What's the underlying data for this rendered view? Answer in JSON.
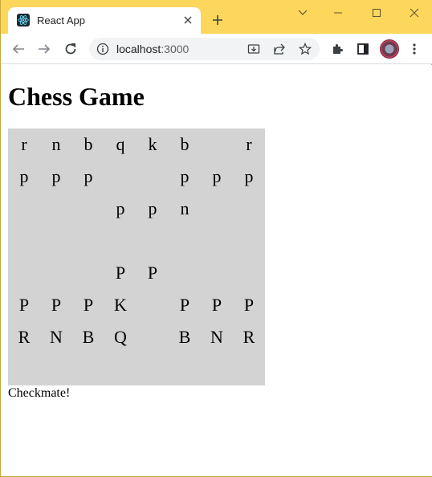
{
  "browser": {
    "tab": {
      "title": "React App",
      "favicon": "react-logo-icon"
    },
    "address": {
      "host": "localhost",
      "port": ":3000"
    },
    "colors": {
      "frame": "#fcd75b"
    }
  },
  "page": {
    "heading": "Chess Game",
    "board": [
      [
        "r",
        "n",
        "b",
        "q",
        "k",
        "b",
        "",
        "r"
      ],
      [
        "p",
        "p",
        "p",
        "",
        "",
        "p",
        "p",
        "p"
      ],
      [
        "",
        "",
        "",
        "p",
        "p",
        "n",
        "",
        ""
      ],
      [
        "",
        "",
        "",
        "",
        "",
        "",
        "",
        ""
      ],
      [
        "",
        "",
        "",
        "P",
        "P",
        "",
        "",
        ""
      ],
      [
        "P",
        "P",
        "P",
        "K",
        "",
        "P",
        "P",
        "P"
      ],
      [
        "R",
        "N",
        "B",
        "Q",
        "",
        "B",
        "N",
        "R"
      ],
      [
        "",
        "",
        "",
        "",
        "",
        "",
        "",
        ""
      ]
    ],
    "status": "Checkmate!",
    "colors": {
      "board_bg": "#d3d3d3"
    }
  }
}
